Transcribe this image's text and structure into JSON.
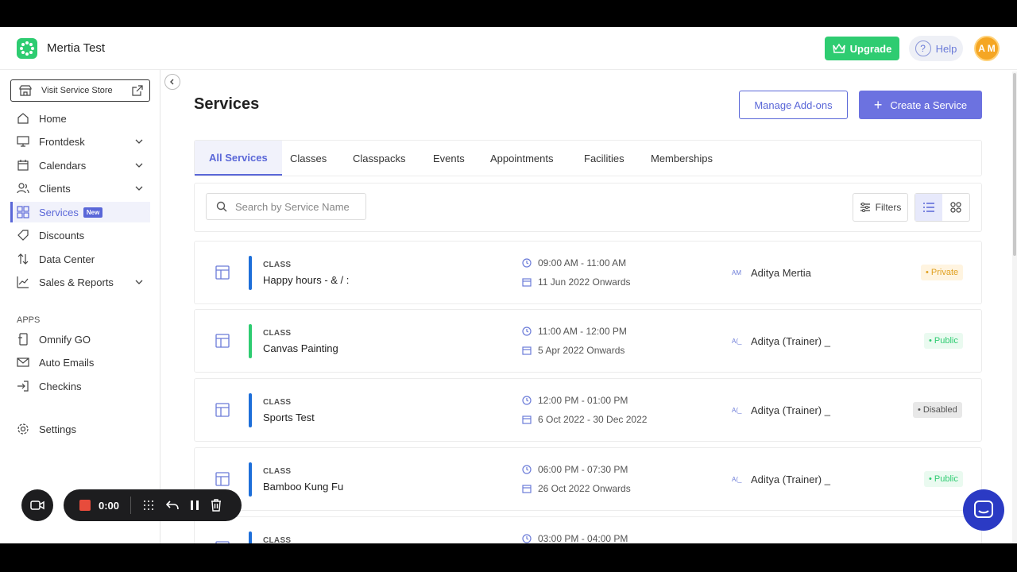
{
  "header": {
    "app_name": "Mertia Test",
    "upgrade_label": "Upgrade",
    "help_label": "Help",
    "help_glyph": "?",
    "avatar_initials": "A M"
  },
  "sidebar": {
    "visit_store": "Visit Service Store",
    "items": [
      {
        "label": "Home",
        "icon": "home-icon"
      },
      {
        "label": "Frontdesk",
        "icon": "monitor-icon"
      },
      {
        "label": "Calendars",
        "icon": "calendar-icon"
      },
      {
        "label": "Clients",
        "icon": "users-icon"
      },
      {
        "label": "Services",
        "icon": "grid-icon",
        "badge": "New"
      },
      {
        "label": "Discounts",
        "icon": "tag-icon"
      },
      {
        "label": "Data Center",
        "icon": "arrows-updown-icon"
      },
      {
        "label": "Sales & Reports",
        "icon": "chart-icon"
      }
    ],
    "apps_label": "APPS",
    "apps": [
      {
        "label": "Omnify GO",
        "icon": "phone-icon"
      },
      {
        "label": "Auto Emails",
        "icon": "mail-icon"
      },
      {
        "label": "Checkins",
        "icon": "login-icon"
      }
    ],
    "settings_label": "Settings"
  },
  "main": {
    "title": "Services",
    "manage_addons": "Manage Add-ons",
    "create_service": "Create a Service",
    "create_plus": "+",
    "tabs": [
      "All Services",
      "Classes",
      "Classpacks",
      "Events",
      "Appointments",
      "Facilities",
      "Memberships"
    ],
    "search_placeholder": "Search by Service Name",
    "filters_label": "Filters"
  },
  "services": [
    {
      "category": "CLASS",
      "name": "Happy hours - & / :",
      "time": "09:00 AM - 11:00 AM",
      "date": "11 Jun 2022 Onwards",
      "instructor_initials": "AM",
      "instructor": "Aditya Mertia",
      "status": "• Private",
      "accent": "#1e6fd9"
    },
    {
      "category": "CLASS",
      "name": "Canvas Painting",
      "time": "11:00 AM - 12:00 PM",
      "date": "5 Apr 2022 Onwards",
      "instructor_initials": "A(_",
      "instructor": "Aditya (Trainer) _",
      "status": "• Public",
      "accent": "#2ecc71"
    },
    {
      "category": "CLASS",
      "name": "Sports Test",
      "time": "12:00 PM - 01:00 PM",
      "date": "6 Oct 2022 - 30 Dec 2022",
      "instructor_initials": "A(_",
      "instructor": "Aditya (Trainer) _",
      "status": "• Disabled",
      "accent": "#1e6fd9"
    },
    {
      "category": "CLASS",
      "name": "Bamboo Kung Fu",
      "time": "06:00 PM - 07:30 PM",
      "date": "26 Oct 2022 Onwards",
      "instructor_initials": "A(_",
      "instructor": "Aditya (Trainer) _",
      "status": "• Public",
      "accent": "#1e6fd9"
    },
    {
      "category": "CLASS",
      "name": "",
      "time": "03:00 PM - 04:00 PM",
      "date": "",
      "instructor_initials": "",
      "instructor": "",
      "status": "",
      "accent": "#1e6fd9"
    }
  ],
  "recorder": {
    "timer": "0:00"
  },
  "colors": {
    "brand_green": "#2ecc71",
    "accent_purple": "#5a67d8"
  }
}
